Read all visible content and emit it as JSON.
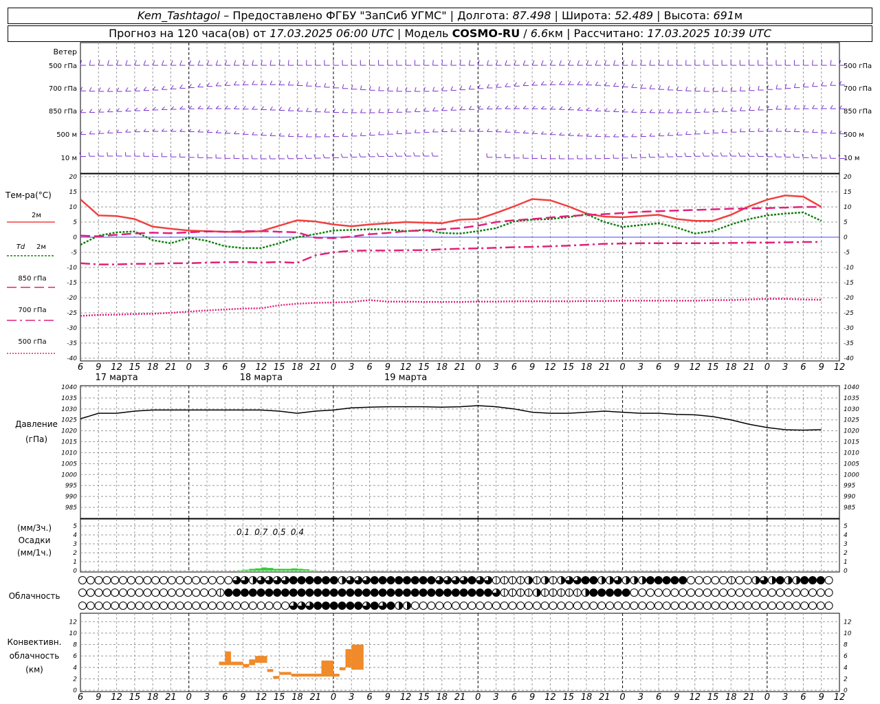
{
  "header": {
    "station": "Kem_Tashtagol",
    "provider": "Предоставлено ФГБУ \"ЗапСиб УГМС\"",
    "lon_label": "Долгота:",
    "lon": "87.498",
    "lat_label": "Широта:",
    "lat": "52.489",
    "alt_label": "Высота:",
    "alt": "691",
    "alt_unit": "м",
    "forecast_label": "Прогноз на 120 часа(ов) от",
    "forecast_start": "17.03.2025 06:00 UTC",
    "model_label": "Модель",
    "model": "COSMO-RU",
    "resolution": "6.6",
    "resolution_unit": "км",
    "computed_label": "Рассчитано:",
    "computed": "17.03.2025 10:39 UTC"
  },
  "chart_data": [
    {
      "type": "line",
      "panel": "wind",
      "ylabel": "Ветер",
      "levels": [
        "500 гПа",
        "700 гПа",
        "850 гПа",
        "500 м",
        "10 м"
      ]
    },
    {
      "type": "line",
      "panel": "temperature",
      "ylabel": "Тем-ра(°C)",
      "ylim": [
        -40,
        20
      ],
      "yticks": [
        20,
        15,
        10,
        5,
        0,
        -5,
        -10,
        -15,
        -20,
        -25,
        -30,
        -35,
        -40
      ],
      "x_hours": [
        0,
        3,
        6,
        9,
        12,
        15,
        18,
        21,
        24,
        27,
        30,
        33,
        36,
        39,
        42,
        45,
        48,
        51,
        54,
        57,
        60,
        63,
        66,
        69,
        72,
        75,
        78,
        81,
        84,
        87,
        90,
        93,
        96,
        99,
        102,
        105,
        108,
        111,
        114,
        117,
        120,
        123,
        126
      ],
      "series": [
        {
          "name": "2м",
          "color": "#f04040",
          "dash": "solid",
          "values": [
            12.5,
            7.2,
            7,
            6,
            3.5,
            2.8,
            2.2,
            2,
            1.8,
            1.7,
            2,
            3.8,
            5.6,
            5.2,
            4.2,
            3.6,
            4.2,
            4.6,
            5,
            4.8,
            4.6,
            5.8,
            6,
            8,
            10.2,
            12.6,
            12.2,
            10.2,
            7.8,
            6.8,
            6.6,
            7,
            7.4,
            6,
            5.4,
            5.4,
            7.4,
            10.2,
            12.4,
            13.8,
            13.4,
            10
          ]
        },
        {
          "name": "Td 2м",
          "color": "#108010",
          "dash": "dot",
          "values": [
            -2.5,
            0.5,
            1.6,
            1.9,
            -1,
            -2,
            -0.2,
            -1.2,
            -3,
            -3.6,
            -3.6,
            -2,
            0,
            1,
            2.2,
            2.4,
            2.6,
            2.6,
            2,
            2.4,
            1.4,
            1.2,
            2,
            3,
            5.2,
            5.8,
            6,
            6.6,
            7.6,
            5,
            3.4,
            4,
            4.6,
            3.2,
            1.2,
            2,
            4.2,
            6,
            7.2,
            7.8,
            8.2,
            5.4
          ]
        },
        {
          "name": "850 гПа",
          "color": "#e0207a",
          "dash": "long-dash",
          "values": [
            0.5,
            0.3,
            0.8,
            1.2,
            1.5,
            1.3,
            1.6,
            1.9,
            1.8,
            2,
            2,
            1.8,
            1.6,
            -0.2,
            -0.3,
            0.2,
            1,
            1.4,
            2,
            2.2,
            2.6,
            3,
            3.8,
            5,
            5.6,
            6,
            6.5,
            7,
            7.3,
            7.6,
            8,
            8.4,
            8.6,
            8.8,
            9,
            9.2,
            9.4,
            9.5,
            9.6,
            9.8,
            10,
            10
          ]
        },
        {
          "name": "700 гПа",
          "color": "#e0207a",
          "dash": "dash-dot",
          "values": [
            -8.6,
            -9,
            -9,
            -8.8,
            -8.8,
            -8.6,
            -8.6,
            -8.4,
            -8.3,
            -8.2,
            -8.4,
            -8.2,
            -8.5,
            -6,
            -5,
            -4.5,
            -4.4,
            -4.4,
            -4.3,
            -4.3,
            -4,
            -3.8,
            -3.7,
            -3.5,
            -3.3,
            -3.2,
            -3,
            -2.8,
            -2.5,
            -2.2,
            -2.1,
            -2,
            -2,
            -2,
            -2,
            -2,
            -1.9,
            -1.8,
            -1.8,
            -1.7,
            -1.6,
            -1.6
          ]
        },
        {
          "name": "500 гПа",
          "color": "#e0207a",
          "dash": "dense-dot",
          "values": [
            -26,
            -25.7,
            -25.6,
            -25.4,
            -25.3,
            -25,
            -24.6,
            -24.2,
            -23.9,
            -23.6,
            -23.5,
            -22.5,
            -22,
            -21.7,
            -21.6,
            -21.4,
            -20.8,
            -21.3,
            -21.3,
            -21.4,
            -21.4,
            -21.4,
            -21.3,
            -21.3,
            -21.2,
            -21.2,
            -21.2,
            -21.2,
            -21.1,
            -21.1,
            -21,
            -21,
            -21,
            -21,
            -21,
            -20.8,
            -20.8,
            -20.6,
            -20.4,
            -20.4,
            -20.6,
            -20.7
          ]
        }
      ]
    },
    {
      "type": "line",
      "panel": "pressure",
      "ylabel": "Давление",
      "yunit": "(гПа)",
      "ylim": [
        985,
        1040
      ],
      "yticks": [
        1040,
        1035,
        1030,
        1025,
        1020,
        1015,
        1010,
        1005,
        1000,
        995,
        990,
        985
      ],
      "series": [
        {
          "name": "",
          "color": "#000000",
          "values": [
            1025.5,
            1028,
            1028,
            1029,
            1029.5,
            1029.5,
            1029.5,
            1029.5,
            1029.5,
            1029.5,
            1029.5,
            1029,
            1028,
            1029,
            1029.5,
            1030.5,
            1030.8,
            1031,
            1031,
            1031,
            1030.8,
            1031,
            1031.5,
            1031,
            1030,
            1028.5,
            1028,
            1028,
            1028.5,
            1029,
            1028.5,
            1028,
            1028,
            1027.5,
            1027.3,
            1026.5,
            1025,
            1023,
            1021.5,
            1020.5,
            1020.3,
            1020.5
          ]
        }
      ]
    },
    {
      "type": "bar",
      "panel": "precipitation",
      "ylabel": "Осадки",
      "yunit_top": "(мм/3ч.)",
      "yunit_bottom": "(мм/1ч.)",
      "ylim": [
        0,
        5
      ],
      "yticks": [
        5,
        4,
        3,
        2,
        1,
        0
      ],
      "labels": [
        {
          "hour": 27,
          "text": "0.1"
        },
        {
          "hour": 30,
          "text": "0.7"
        },
        {
          "hour": 33,
          "text": "0.5"
        },
        {
          "hour": 36,
          "text": "0.4"
        }
      ],
      "bars_hourly": [
        {
          "hour": 26,
          "value": 0.05
        },
        {
          "hour": 27,
          "value": 0.1
        },
        {
          "hour": 28,
          "value": 0.2
        },
        {
          "hour": 29,
          "value": 0.25
        },
        {
          "hour": 30,
          "value": 0.35
        },
        {
          "hour": 31,
          "value": 0.3
        },
        {
          "hour": 32,
          "value": 0.2
        },
        {
          "hour": 33,
          "value": 0.2
        },
        {
          "hour": 34,
          "value": 0.2
        },
        {
          "hour": 35,
          "value": 0.25
        },
        {
          "hour": 36,
          "value": 0.2
        },
        {
          "hour": 37,
          "value": 0.15
        },
        {
          "hour": 38,
          "value": 0.05
        }
      ]
    },
    {
      "type": "table",
      "panel": "cloudiness",
      "ylabel": "Облачность",
      "rows_cover_0to4": [
        "000000000000000000033233334444442333444444443333433111121212334422322244444000001002324224440",
        "000000000000000001444444444444444444444444444444444311112111112444440000000000000000000000000",
        "000000000000000000000000003334444443434220000000000000000000000000000000000000000000000000000"
      ]
    },
    {
      "type": "bar",
      "panel": "convective",
      "ylabel": "Конвективн. облачность (км)",
      "ylim": [
        0,
        13
      ],
      "yticks": [
        12,
        10,
        8,
        6,
        4,
        2,
        0
      ],
      "segments": [
        {
          "h0": 23,
          "h1": 24,
          "base": 4.4,
          "top": 5
        },
        {
          "h0": 24,
          "h1": 25,
          "base": 4.4,
          "top": 6.8
        },
        {
          "h0": 25,
          "h1": 27,
          "base": 4.4,
          "top": 5
        },
        {
          "h0": 27,
          "h1": 28,
          "base": 4,
          "top": 4.6
        },
        {
          "h0": 28,
          "h1": 29,
          "base": 4.4,
          "top": 5.4
        },
        {
          "h0": 29,
          "h1": 31,
          "base": 4.8,
          "top": 6
        },
        {
          "h0": 31,
          "h1": 32,
          "base": 3.2,
          "top": 3.7
        },
        {
          "h0": 32,
          "h1": 33,
          "base": 2,
          "top": 2.5
        },
        {
          "h0": 33,
          "h1": 35,
          "base": 2.7,
          "top": 3.2
        },
        {
          "h0": 35,
          "h1": 40,
          "base": 2.4,
          "top": 2.9
        },
        {
          "h0": 40,
          "h1": 42,
          "base": 2.4,
          "top": 5.2
        },
        {
          "h0": 42,
          "h1": 43,
          "base": 2.4,
          "top": 2.9
        },
        {
          "h0": 43,
          "h1": 44,
          "base": 3.5,
          "top": 4
        },
        {
          "h0": 44,
          "h1": 45,
          "base": 4,
          "top": 7.2
        },
        {
          "h0": 45,
          "h1": 47,
          "base": 3.6,
          "top": 8
        }
      ]
    }
  ],
  "axis": {
    "hour_ticks": [
      "6",
      "9",
      "12",
      "15",
      "18",
      "21",
      "0",
      "3",
      "6",
      "9",
      "12",
      "15",
      "18",
      "21",
      "0",
      "3",
      "6",
      "9",
      "12",
      "15",
      "18",
      "21",
      "0",
      "3",
      "6",
      "9",
      "12",
      "15",
      "18",
      "21",
      "0",
      "3",
      "6",
      "9",
      "12",
      "15",
      "18",
      "21",
      "0",
      "3",
      "6",
      "9",
      "12"
    ],
    "days": [
      {
        "label": "17 марта",
        "hour": 6
      },
      {
        "label": "18 марта",
        "hour": 30
      },
      {
        "label": "19 марта",
        "hour": 54
      }
    ]
  },
  "legend": {
    "t2m": "2м",
    "td2m_a": "Td",
    "td2m_b": "2м",
    "t850": "850 гПа",
    "t700": "700 гПа",
    "t500": "500 гПа"
  },
  "colors": {
    "temp2m": "#f04040",
    "dew": "#108010",
    "upper": "#e0207a",
    "wind": "#7a2fd0",
    "conv": "#f08a2a",
    "precip": "#30d030",
    "grid": "#999999"
  }
}
